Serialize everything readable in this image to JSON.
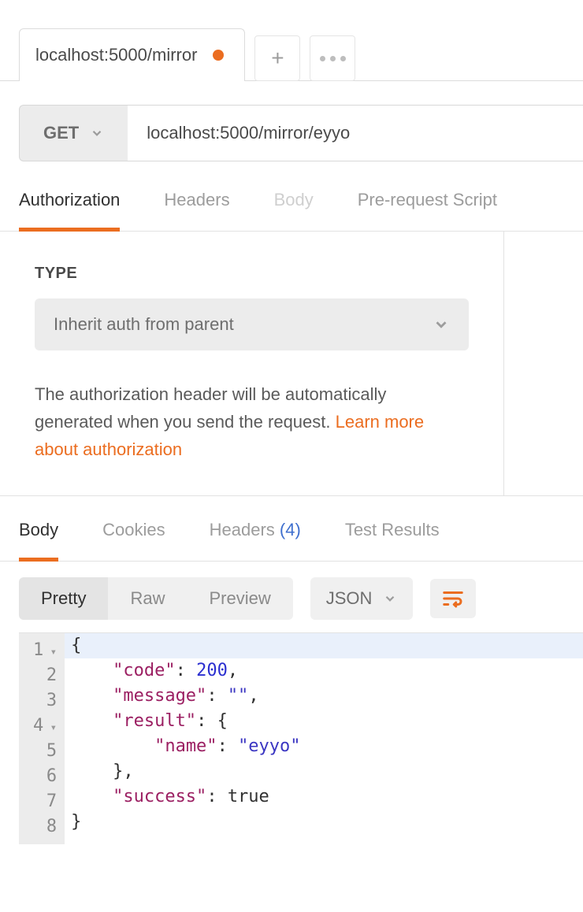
{
  "tabs": {
    "active": {
      "label": "localhost:5000/mirror"
    },
    "add_tooltip": "New Tab",
    "more_tooltip": "More"
  },
  "request": {
    "method": "GET",
    "url": "localhost:5000/mirror/eyyo",
    "tabs": {
      "authorization": "Authorization",
      "headers": "Headers",
      "body": "Body",
      "prerequest": "Pre-request Script"
    }
  },
  "auth": {
    "type_label": "TYPE",
    "selected": "Inherit auth from parent",
    "description_prefix": "The authorization header will be automatically generated when you send the request. ",
    "learn_more": "Learn more about authorization"
  },
  "response": {
    "tabs": {
      "body": "Body",
      "cookies": "Cookies",
      "headers_label": "Headers",
      "headers_count": "(4)",
      "test_results": "Test Results"
    },
    "view_modes": {
      "pretty": "Pretty",
      "raw": "Raw",
      "preview": "Preview"
    },
    "format": "JSON",
    "body_lines": [
      {
        "n": 1,
        "fold": true,
        "tokens": [
          {
            "t": "{",
            "c": "punct"
          }
        ]
      },
      {
        "n": 2,
        "fold": false,
        "tokens": [
          {
            "t": "    ",
            "c": "plain"
          },
          {
            "t": "\"code\"",
            "c": "key"
          },
          {
            "t": ": ",
            "c": "punct"
          },
          {
            "t": "200",
            "c": "num"
          },
          {
            "t": ",",
            "c": "punct"
          }
        ]
      },
      {
        "n": 3,
        "fold": false,
        "tokens": [
          {
            "t": "    ",
            "c": "plain"
          },
          {
            "t": "\"message\"",
            "c": "key"
          },
          {
            "t": ": ",
            "c": "punct"
          },
          {
            "t": "\"\"",
            "c": "str"
          },
          {
            "t": ",",
            "c": "punct"
          }
        ]
      },
      {
        "n": 4,
        "fold": true,
        "tokens": [
          {
            "t": "    ",
            "c": "plain"
          },
          {
            "t": "\"result\"",
            "c": "key"
          },
          {
            "t": ": ",
            "c": "punct"
          },
          {
            "t": "{",
            "c": "punct"
          }
        ]
      },
      {
        "n": 5,
        "fold": false,
        "tokens": [
          {
            "t": "        ",
            "c": "plain"
          },
          {
            "t": "\"name\"",
            "c": "key"
          },
          {
            "t": ": ",
            "c": "punct"
          },
          {
            "t": "\"eyyo\"",
            "c": "str"
          }
        ]
      },
      {
        "n": 6,
        "fold": false,
        "tokens": [
          {
            "t": "    ",
            "c": "plain"
          },
          {
            "t": "},",
            "c": "punct"
          }
        ]
      },
      {
        "n": 7,
        "fold": false,
        "tokens": [
          {
            "t": "    ",
            "c": "plain"
          },
          {
            "t": "\"success\"",
            "c": "key"
          },
          {
            "t": ": ",
            "c": "punct"
          },
          {
            "t": "true",
            "c": "bool"
          }
        ]
      },
      {
        "n": 8,
        "fold": false,
        "tokens": [
          {
            "t": "}",
            "c": "punct"
          }
        ]
      }
    ]
  }
}
